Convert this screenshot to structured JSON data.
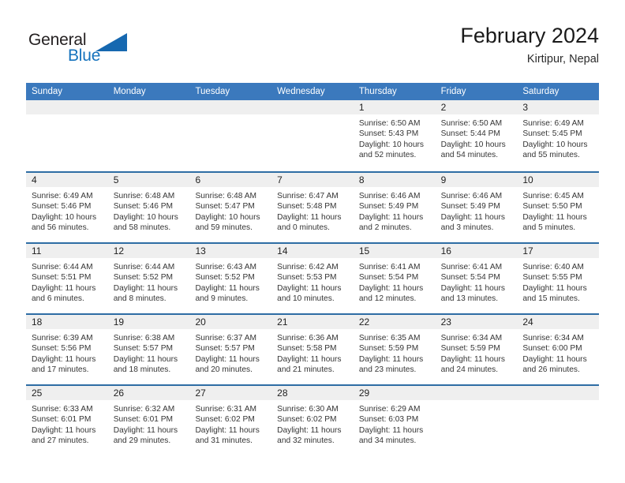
{
  "brand": {
    "name_top": "General",
    "name_bottom": "Blue",
    "triangle_icon": "triangle-icon",
    "accent_color": "#1673bd"
  },
  "header": {
    "title": "February 2024",
    "subtitle": "Kirtipur, Nepal"
  },
  "colors": {
    "header_blue": "#3b79bd",
    "row_rule_blue": "#2e6da4",
    "day_band_gray": "#efefef",
    "text_dark": "#353535"
  },
  "weekdays": [
    "Sunday",
    "Monday",
    "Tuesday",
    "Wednesday",
    "Thursday",
    "Friday",
    "Saturday"
  ],
  "weeks": [
    [
      {
        "day": "",
        "lines": []
      },
      {
        "day": "",
        "lines": []
      },
      {
        "day": "",
        "lines": []
      },
      {
        "day": "",
        "lines": []
      },
      {
        "day": "1",
        "lines": [
          "Sunrise: 6:50 AM",
          "Sunset: 5:43 PM",
          "Daylight: 10 hours",
          "and 52 minutes."
        ]
      },
      {
        "day": "2",
        "lines": [
          "Sunrise: 6:50 AM",
          "Sunset: 5:44 PM",
          "Daylight: 10 hours",
          "and 54 minutes."
        ]
      },
      {
        "day": "3",
        "lines": [
          "Sunrise: 6:49 AM",
          "Sunset: 5:45 PM",
          "Daylight: 10 hours",
          "and 55 minutes."
        ]
      }
    ],
    [
      {
        "day": "4",
        "lines": [
          "Sunrise: 6:49 AM",
          "Sunset: 5:46 PM",
          "Daylight: 10 hours",
          "and 56 minutes."
        ]
      },
      {
        "day": "5",
        "lines": [
          "Sunrise: 6:48 AM",
          "Sunset: 5:46 PM",
          "Daylight: 10 hours",
          "and 58 minutes."
        ]
      },
      {
        "day": "6",
        "lines": [
          "Sunrise: 6:48 AM",
          "Sunset: 5:47 PM",
          "Daylight: 10 hours",
          "and 59 minutes."
        ]
      },
      {
        "day": "7",
        "lines": [
          "Sunrise: 6:47 AM",
          "Sunset: 5:48 PM",
          "Daylight: 11 hours",
          "and 0 minutes."
        ]
      },
      {
        "day": "8",
        "lines": [
          "Sunrise: 6:46 AM",
          "Sunset: 5:49 PM",
          "Daylight: 11 hours",
          "and 2 minutes."
        ]
      },
      {
        "day": "9",
        "lines": [
          "Sunrise: 6:46 AM",
          "Sunset: 5:49 PM",
          "Daylight: 11 hours",
          "and 3 minutes."
        ]
      },
      {
        "day": "10",
        "lines": [
          "Sunrise: 6:45 AM",
          "Sunset: 5:50 PM",
          "Daylight: 11 hours",
          "and 5 minutes."
        ]
      }
    ],
    [
      {
        "day": "11",
        "lines": [
          "Sunrise: 6:44 AM",
          "Sunset: 5:51 PM",
          "Daylight: 11 hours",
          "and 6 minutes."
        ]
      },
      {
        "day": "12",
        "lines": [
          "Sunrise: 6:44 AM",
          "Sunset: 5:52 PM",
          "Daylight: 11 hours",
          "and 8 minutes."
        ]
      },
      {
        "day": "13",
        "lines": [
          "Sunrise: 6:43 AM",
          "Sunset: 5:52 PM",
          "Daylight: 11 hours",
          "and 9 minutes."
        ]
      },
      {
        "day": "14",
        "lines": [
          "Sunrise: 6:42 AM",
          "Sunset: 5:53 PM",
          "Daylight: 11 hours",
          "and 10 minutes."
        ]
      },
      {
        "day": "15",
        "lines": [
          "Sunrise: 6:41 AM",
          "Sunset: 5:54 PM",
          "Daylight: 11 hours",
          "and 12 minutes."
        ]
      },
      {
        "day": "16",
        "lines": [
          "Sunrise: 6:41 AM",
          "Sunset: 5:54 PM",
          "Daylight: 11 hours",
          "and 13 minutes."
        ]
      },
      {
        "day": "17",
        "lines": [
          "Sunrise: 6:40 AM",
          "Sunset: 5:55 PM",
          "Daylight: 11 hours",
          "and 15 minutes."
        ]
      }
    ],
    [
      {
        "day": "18",
        "lines": [
          "Sunrise: 6:39 AM",
          "Sunset: 5:56 PM",
          "Daylight: 11 hours",
          "and 17 minutes."
        ]
      },
      {
        "day": "19",
        "lines": [
          "Sunrise: 6:38 AM",
          "Sunset: 5:57 PM",
          "Daylight: 11 hours",
          "and 18 minutes."
        ]
      },
      {
        "day": "20",
        "lines": [
          "Sunrise: 6:37 AM",
          "Sunset: 5:57 PM",
          "Daylight: 11 hours",
          "and 20 minutes."
        ]
      },
      {
        "day": "21",
        "lines": [
          "Sunrise: 6:36 AM",
          "Sunset: 5:58 PM",
          "Daylight: 11 hours",
          "and 21 minutes."
        ]
      },
      {
        "day": "22",
        "lines": [
          "Sunrise: 6:35 AM",
          "Sunset: 5:59 PM",
          "Daylight: 11 hours",
          "and 23 minutes."
        ]
      },
      {
        "day": "23",
        "lines": [
          "Sunrise: 6:34 AM",
          "Sunset: 5:59 PM",
          "Daylight: 11 hours",
          "and 24 minutes."
        ]
      },
      {
        "day": "24",
        "lines": [
          "Sunrise: 6:34 AM",
          "Sunset: 6:00 PM",
          "Daylight: 11 hours",
          "and 26 minutes."
        ]
      }
    ],
    [
      {
        "day": "25",
        "lines": [
          "Sunrise: 6:33 AM",
          "Sunset: 6:01 PM",
          "Daylight: 11 hours",
          "and 27 minutes."
        ]
      },
      {
        "day": "26",
        "lines": [
          "Sunrise: 6:32 AM",
          "Sunset: 6:01 PM",
          "Daylight: 11 hours",
          "and 29 minutes."
        ]
      },
      {
        "day": "27",
        "lines": [
          "Sunrise: 6:31 AM",
          "Sunset: 6:02 PM",
          "Daylight: 11 hours",
          "and 31 minutes."
        ]
      },
      {
        "day": "28",
        "lines": [
          "Sunrise: 6:30 AM",
          "Sunset: 6:02 PM",
          "Daylight: 11 hours",
          "and 32 minutes."
        ]
      },
      {
        "day": "29",
        "lines": [
          "Sunrise: 6:29 AM",
          "Sunset: 6:03 PM",
          "Daylight: 11 hours",
          "and 34 minutes."
        ]
      },
      {
        "day": "",
        "lines": []
      },
      {
        "day": "",
        "lines": []
      }
    ]
  ]
}
